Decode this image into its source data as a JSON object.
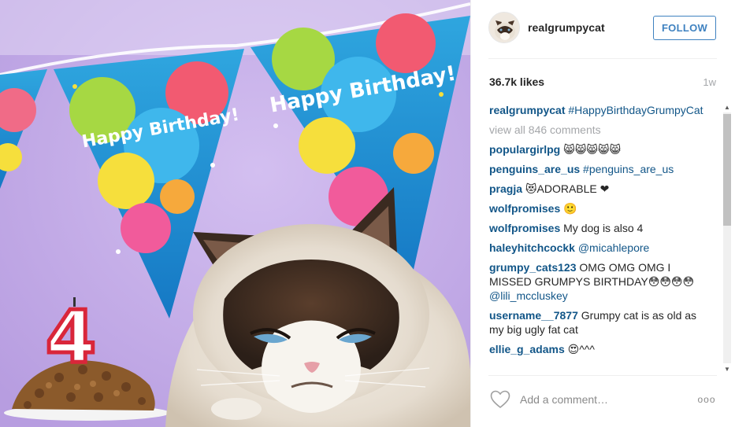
{
  "post": {
    "username": "realgrumpycat",
    "follow_label": "FOLLOW",
    "likes": "36.7k likes",
    "time_ago": "1w",
    "caption": {
      "user": "realgrumpycat",
      "text": "#HappyBirthdayGrumpyCat"
    },
    "view_all": "view all 846 comments",
    "comments": [
      {
        "user": "populargirlpg",
        "text": "😸😸😸😸😸"
      },
      {
        "user": "penguins_are_us",
        "tag": "#penguins_are_us"
      },
      {
        "user": "pragja",
        "text": "😻ADORABLE ❤"
      },
      {
        "user": "wolfpromises",
        "text": "🙂"
      },
      {
        "user": "wolfpromises",
        "text": "My dog is also 4"
      },
      {
        "user": "haleyhitchcockk",
        "tag": "@micahlepore"
      },
      {
        "user": "grumpy_cats123",
        "text": "OMG OMG OMG I MISSED GRUMPYS BIRTHDAY😳😳😳😳",
        "tag": "@lili_mccluskey"
      },
      {
        "user": "username__7877",
        "text": "Grumpy cat is as old as my big ugly fat cat"
      },
      {
        "user": "ellie_g_adams",
        "text": "😍^^^"
      }
    ],
    "add_comment_placeholder": "Add a comment…",
    "more_label": "ooo",
    "icons": {
      "like": "heart-outline-icon",
      "more": "more-options-icon",
      "scroll_up": "scroll-up-arrow",
      "scroll_down": "scroll-down-arrow"
    },
    "photo_text": {
      "banner_left": "Happy Birthday!",
      "banner_right": "Happy Birthday!",
      "candle": "4"
    },
    "colors": {
      "link": "#125688",
      "follow": "#3f82c0",
      "photo_bg": "#c9b2ea"
    }
  }
}
